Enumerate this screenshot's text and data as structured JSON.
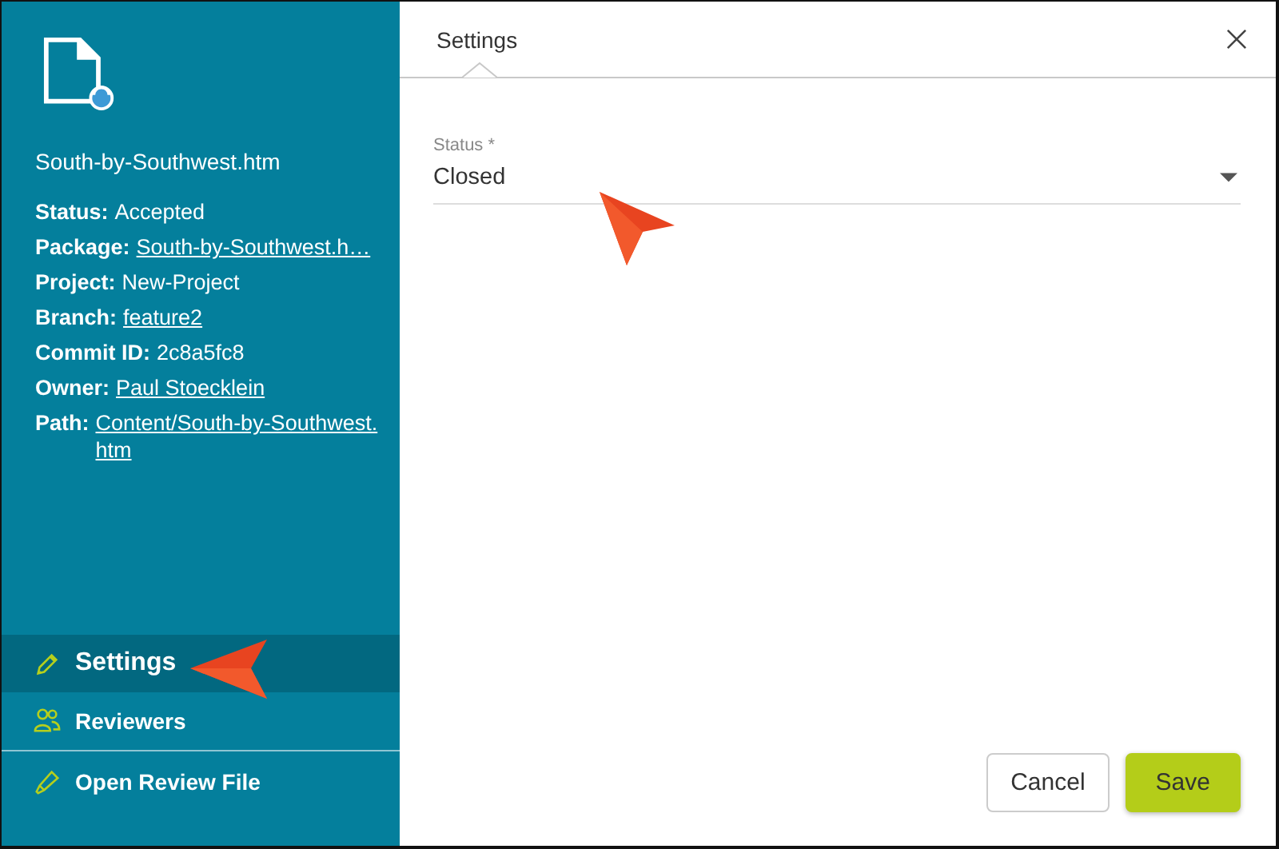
{
  "file": {
    "name": "South-by-Southwest.htm"
  },
  "details": [
    {
      "label": "Status:",
      "value": "Accepted",
      "link": false
    },
    {
      "label": "Package:",
      "value": "South-by-Southwest.h…",
      "link": true
    },
    {
      "label": "Project:",
      "value": "New-Project",
      "link": false
    },
    {
      "label": "Branch:",
      "value": "feature2",
      "link": true
    },
    {
      "label": "Commit ID:",
      "value": "2c8a5fc8",
      "link": false
    },
    {
      "label": "Owner:",
      "value": "Paul Stoecklein",
      "link": true
    },
    {
      "label": "Path:",
      "value": "Content/South-by-Southwest.htm",
      "link": true
    }
  ],
  "nav": [
    {
      "kind": "pencil",
      "label": "Settings",
      "selected": true
    },
    {
      "kind": "people",
      "label": "Reviewers",
      "selected": false
    }
  ],
  "actions": [
    {
      "kind": "marker",
      "label": "Open Review File"
    }
  ],
  "panel": {
    "tab": "Settings",
    "field": {
      "label": "Status *",
      "value": "Closed"
    }
  },
  "buttons": [
    {
      "kind": "secondary",
      "label": "Cancel"
    },
    {
      "kind": "primary",
      "label": "Save"
    }
  ]
}
